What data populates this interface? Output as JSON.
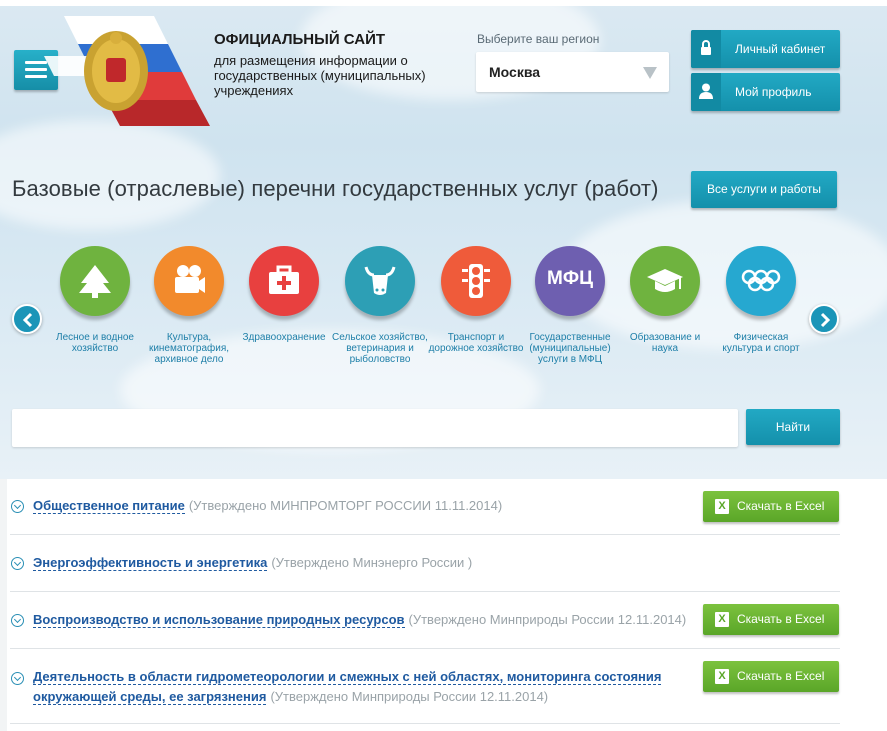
{
  "header": {
    "title": "ОФИЦИАЛЬНЫЙ САЙТ",
    "subtitle": "для размещения информации о государственных (муниципальных) учреждениях",
    "region_label": "Выберите ваш регион",
    "region_value": "Москва",
    "account_button": "Личный кабинет",
    "profile_button": "Мой профиль"
  },
  "main": {
    "heading": "Базовые (отраслевые) перечни государственных услуг (работ)",
    "all_services_button": "Все услуги и работы",
    "search_placeholder": "",
    "search_button": "Найти"
  },
  "categories": [
    {
      "label": "Лесное и водное хозяйство",
      "color": "#6fb33f",
      "icon": "tree-icon"
    },
    {
      "label": "Культура, кинематография, архивное дело",
      "color": "#f28a2c",
      "icon": "camera-icon"
    },
    {
      "label": "Здравоохранение",
      "color": "#e8403f",
      "icon": "medkit-icon"
    },
    {
      "label": "Сельское хозяйство, ветеринария и рыболовство",
      "color": "#2d9fb5",
      "icon": "cow-icon"
    },
    {
      "label": "Транспорт и дорожное хозяйство",
      "color": "#ef5b3a",
      "icon": "traffic-light-icon"
    },
    {
      "label": "Государственные (муниципальные) услуги в МФЦ",
      "color": "#6e5fb0",
      "icon": "mfc-icon",
      "badge": "МФЦ"
    },
    {
      "label": "Образование и наука",
      "color": "#6fb33f",
      "icon": "graduation-cap-icon"
    },
    {
      "label": "Физическая культура и спорт",
      "color": "#26a8d0",
      "icon": "olympic-rings-icon"
    }
  ],
  "list": [
    {
      "title": "Общественное питание",
      "note": "(Утверждено МИНПРОМТОРГ РОССИИ 11.11.2014)",
      "has_excel": true
    },
    {
      "title": "Энергоэффективность и энергетика",
      "note": "(Утверждено Минэнерго России )",
      "has_excel": false
    },
    {
      "title": "Воспроизводство и использование природных ресурсов",
      "note": "(Утверждено Минприроды России 12.11.2014)",
      "has_excel": true
    },
    {
      "title": "Деятельность в области гидрометеорологии и смежных с ней областях, мониторинга состояния окружающей среды, ее загрязнения",
      "note": "(Утверждено Минприроды России 12.11.2014)",
      "has_excel": true
    }
  ],
  "excel_label": "Скачать в Excel",
  "colors": {
    "accent": "#1b9bb8",
    "excel": "#6cb535",
    "link": "#1f5aa0"
  }
}
